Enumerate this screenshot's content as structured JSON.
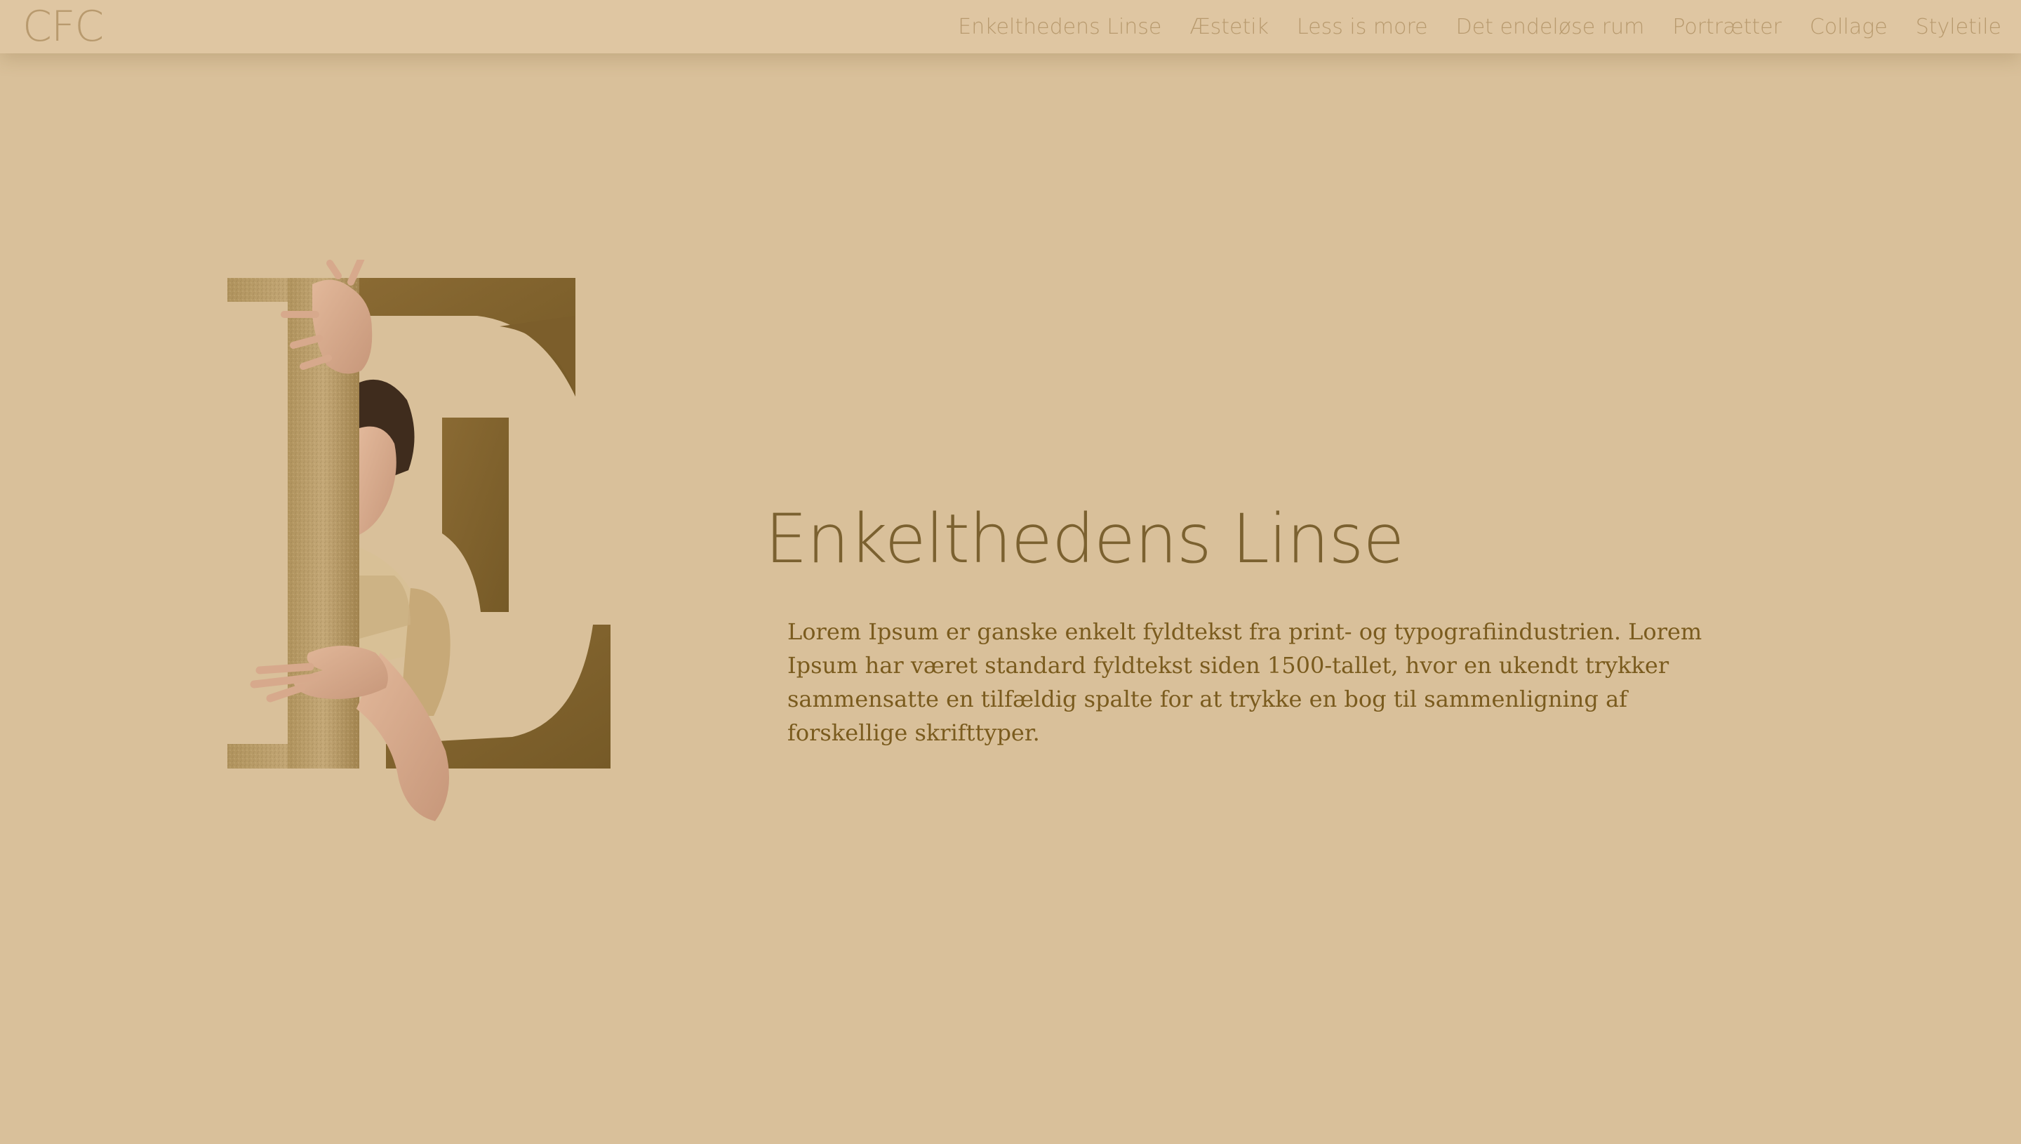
{
  "header": {
    "logo": "CFC",
    "nav": [
      {
        "label": "Enkelthedens Linse"
      },
      {
        "label": "Æstetik"
      },
      {
        "label": "Less is more"
      },
      {
        "label": "Det endeløse rum"
      },
      {
        "label": "Portrætter"
      },
      {
        "label": "Collage"
      },
      {
        "label": "Styletile"
      }
    ]
  },
  "hero": {
    "graphic_icon": "letter-e-collage-icon",
    "title": "Enkelthedens Linse",
    "body": "Lorem Ipsum er ganske enkelt fyldtekst fra print- og typografiindustrien. Lorem Ipsum har været standard fyldtekst siden 1500-tallet, hvor en ukendt trykker sammensatte en tilfældig spalte for at trykke en bog til sammenligning af forskellige skrifttyper."
  },
  "colors": {
    "background": "#d9c09a",
    "navbar": "#dfc6a2",
    "nav_text": "#b89a6e",
    "accent_brown": "#7b6130",
    "body_text": "#7a5b1e"
  }
}
